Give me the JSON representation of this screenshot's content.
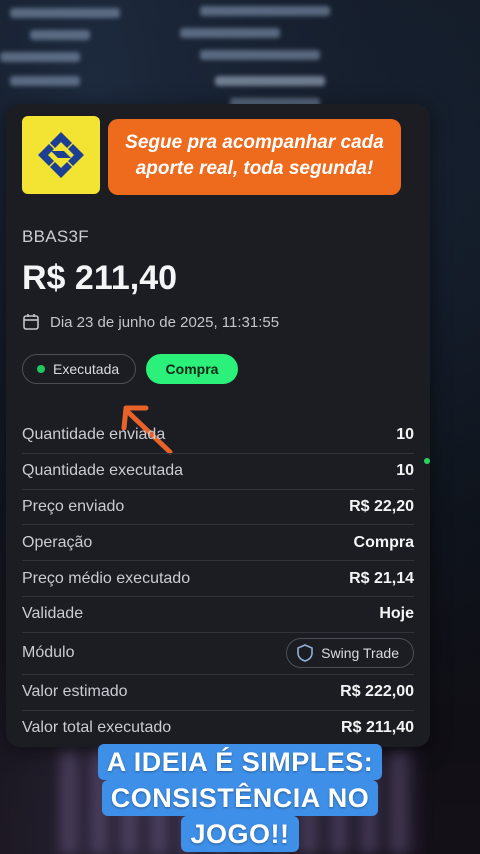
{
  "banner": {
    "line1": "Segue pra acompanhar cada",
    "line2": "aporte real, toda segunda!"
  },
  "order": {
    "ticker": "BBAS3F",
    "price": "R$ 211,40",
    "date": "Dia 23 de junho de 2025, 11:31:55",
    "status": "Executada",
    "side": "Compra"
  },
  "details": [
    {
      "label": "Quantidade enviada",
      "value": "10"
    },
    {
      "label": "Quantidade executada",
      "value": "10"
    },
    {
      "label": "Preço enviado",
      "value": "R$ 22,20"
    },
    {
      "label": "Operação",
      "value": "Compra"
    },
    {
      "label": "Preço médio executado",
      "value": "R$ 21,14"
    },
    {
      "label": "Validade",
      "value": "Hoje"
    },
    {
      "label": "Módulo",
      "value": "Swing Trade"
    },
    {
      "label": "Valor estimado",
      "value": "R$ 222,00"
    },
    {
      "label": "Valor total executado",
      "value": "R$ 211,40"
    }
  ],
  "caption": {
    "line1": "A IDEIA É SIMPLES:",
    "line2": "CONSISTÊNCIA NO",
    "line3": "JOGO!!"
  },
  "colors": {
    "banner_bg": "#ee6a1d",
    "logo_bg": "#f3e332",
    "buy_accent": "#2bf07a",
    "status_dot": "#1fc95d",
    "caption_bg": "#3e8fe8",
    "arrow": "#e8622a"
  },
  "icons": {
    "logo": "banco-do-brasil-logo",
    "date": "calendar-icon",
    "module": "shield-icon",
    "pointer": "arrow-icon"
  }
}
